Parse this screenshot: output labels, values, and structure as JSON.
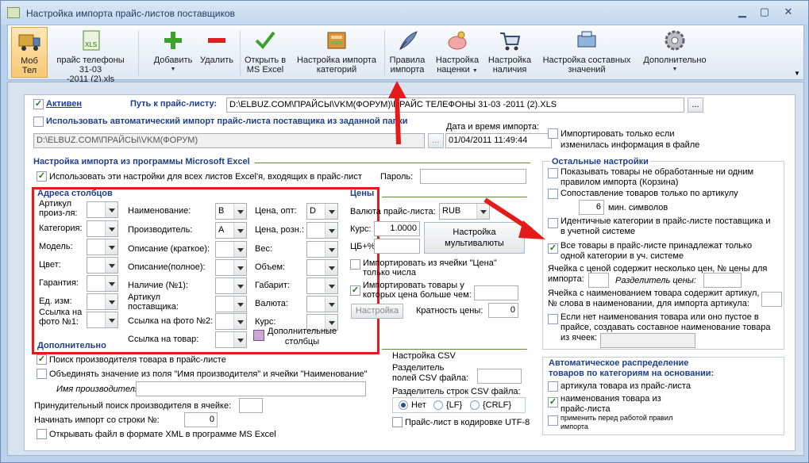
{
  "window": {
    "title": "Настройка импорта прайс-листов поставщиков",
    "min": "▁",
    "max": "▢",
    "close": "✕"
  },
  "toolbar": {
    "b1_1": "Моб",
    "b1_2": "Тел",
    "b1_dd": "▼",
    "b2_1": "прайс телефоны 31-03",
    "b2_2": "-2011 (2).xls",
    "b2_dd": "▼",
    "xls": "XLS",
    "add": "Добавить",
    "add_dd": "▼",
    "del": "Удалить",
    "open1": "Открыть в",
    "open2": "MS Excel",
    "cat1": "Настройка импорта",
    "cat2": "категорий",
    "rules1": "Правила",
    "rules2": "импорта",
    "markup1": "Настройка",
    "markup2": "наценки",
    "markup_dd": "▼",
    "avail1": "Настройка",
    "avail2": "наличия",
    "comp1": "Настройка составных",
    "comp2": "значений",
    "more": "Дополнительно",
    "more_dd": "▼",
    "scroll": "▼"
  },
  "top": {
    "active": "Активен",
    "path_label": "Путь к прайс-листу:",
    "path": "D:\\ELBUZ.COM\\ПРАЙСЫ\\VKM(ФОРУМ)\\ПРАЙС ТЕЛЕФОНЫ 31-03 -2011 (2).XLS",
    "browse": "...",
    "auto_label": "Использовать автоматический импорт прайс-листа поставщика из заданной папки",
    "auto_path": "D:\\ELBUZ.COM\\ПРАЙСЫ\\VKM(ФОРУМ)",
    "date_label": "Дата и время импорта:",
    "date": "01/04/2011 11:49:44",
    "changed1": "Импортировать только если",
    "changed2": "изменилась информация в файле"
  },
  "excel": {
    "title": "Настройка импорта из программы Microsoft Excel",
    "use_all": "Использовать эти настройки для всех листов Excel'я, входящих в прайс-лист",
    "password": "Пароль:"
  },
  "cols": {
    "title": "Адреса столбцов",
    "art1": "Артикул",
    "art2": "произ-ля:",
    "cat": "Категория:",
    "model": "Модель:",
    "color": "Цвет:",
    "warr": "Гарантия:",
    "unit": "Ед. изм:",
    "photo1": "Ссылка на",
    "photo2": "фото №1:",
    "name": "Наименование:",
    "name_v": "B",
    "maker": "Производитель:",
    "maker_v": "A",
    "desc_s": "Описание (краткое):",
    "desc_f": "Описание(полное):",
    "avail": "Наличие (№1):",
    "sart1": "Артикул",
    "sart2": "поставщика:",
    "photo_n": "Ссылка на фото №2:",
    "goods": "Ссылка на товар:",
    "opt": "Цена, опт:",
    "opt_v": "D",
    "rozn": "Цена, розн.:",
    "weight": "Вес:",
    "volume": "Объем:",
    "dims": "Габарит:",
    "curr": "Валюта:",
    "rate": "Курс:",
    "extra1": "Дополнительные",
    "extra2": "столбцы"
  },
  "prices": {
    "title": "Цены",
    "currency": "Валюта прайс-листа:",
    "currency_v": "RUB",
    "rate": "Курс:",
    "rate_v": "1.0000",
    "cb": "ЦБ+%",
    "multi1": "Настройка",
    "multi2": "мультивалюты",
    "cell1": "Импортировать из ячейки \"Цена\"",
    "cell2": "только числа",
    "gt1": "Импортировать товары у",
    "gt2": "которых цена больше чем:",
    "setup": "Настройка",
    "mult": "Кратность цены:",
    "mult_v": "0"
  },
  "additional": {
    "title": "Дополнительно",
    "search": "Поиск производителя товара в прайс-листе",
    "join": "Объединять значение из поля \"Имя производителя\" и ячейки \"Наименование\"",
    "maker_name": "Имя производителя:",
    "forced": "Принудительный поиск производителя в ячейке:",
    "start": "Начинать импорт со строки №:",
    "start_v": "0",
    "xml": "Открывать файл в формате XML в программе MS Excel"
  },
  "csv": {
    "title": "Настройка CSV",
    "sep1": "Разделитель",
    "sep2": "полей CSV файла:",
    "rows": "Разделитель строк CSV файла:",
    "none": "Нет",
    "lf": "{LF}",
    "crlf": "{CRLF}",
    "utf": "Прайс-лист в кодировке UTF-8"
  },
  "other": {
    "title": "Остальные настройки",
    "show1": "Показывать товары не обработанные ни одним",
    "show2": "правилом импорта (Корзина)",
    "match": "Сопоставление товаров только по артикулу",
    "min_v": "6",
    "min": "мин. символов",
    "ident1": "Идентичные категории в прайс-листе поставщика и",
    "ident2": "в учетной системе",
    "all1": "Все товары в прайс-листе принадлежат только",
    "all2": "одной категории в уч. системе",
    "multi1": "Ячейка с ценой содержит несколько цен, № цены для",
    "multi2": "импорта:",
    "delim": "Разделитель цены:",
    "word1": "Ячейка с наименованием товара содержит артикул,",
    "word2": "№ слова в наименовании, для импорта артикула:",
    "compose1": "Если нет наименования товара или оно пустое в",
    "compose2": "прайсе, создавать составное наименование товара",
    "compose3": "из ячеек:",
    "browse": "..."
  },
  "autodist": {
    "title1": "Автоматическое распределение",
    "title2": "товаров по категориям на основании:",
    "art": "артикула товара из прайс-листа",
    "name1": "наименования товара из",
    "name2": "прайс-листа",
    "before1": "применить перед работой правил",
    "before2": "импорта"
  },
  "check": "✓"
}
